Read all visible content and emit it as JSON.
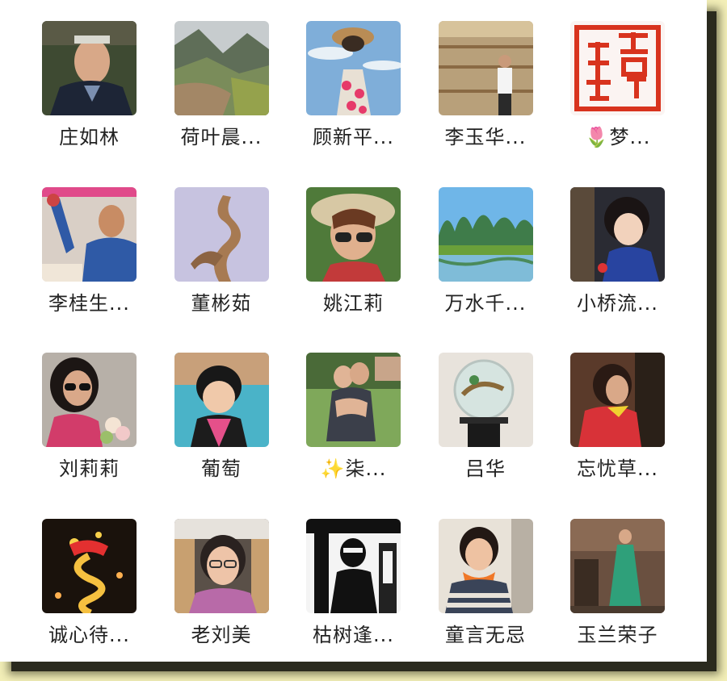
{
  "contacts": [
    {
      "name": "庄如林",
      "avatar": "portrait-man-jacket-icon"
    },
    {
      "name": "荷叶晨...",
      "avatar": "mountain-river-icon"
    },
    {
      "name": "顾新平...",
      "avatar": "girl-straw-hat-icon"
    },
    {
      "name": "李玉华...",
      "avatar": "man-in-atrium-icon"
    },
    {
      "name": "🌷梦...",
      "avatar": "red-seal-stamp-icon"
    },
    {
      "name": "李桂生...",
      "avatar": "man-waving-icon"
    },
    {
      "name": "董彬茹",
      "avatar": "wood-sculpture-icon"
    },
    {
      "name": "姚江莉",
      "avatar": "woman-sunhat-sunglasses-icon"
    },
    {
      "name": "万水千...",
      "avatar": "karst-lake-landscape-icon"
    },
    {
      "name": "小桥流...",
      "avatar": "little-girl-icon"
    },
    {
      "name": "刘莉莉",
      "avatar": "woman-sunglasses-flowers-icon"
    },
    {
      "name": "葡萄",
      "avatar": "child-pink-shirt-icon"
    },
    {
      "name": "✨柒...",
      "avatar": "couple-hugging-icon"
    },
    {
      "name": "吕华",
      "avatar": "painted-plate-icon"
    },
    {
      "name": "忘忧草...",
      "avatar": "woman-red-coat-icon"
    },
    {
      "name": "诚心待...",
      "avatar": "dragon-lantern-icon"
    },
    {
      "name": "老刘美",
      "avatar": "woman-glasses-train-icon"
    },
    {
      "name": "枯树逢...",
      "avatar": "bw-crowd-photo-icon"
    },
    {
      "name": "童言无忌",
      "avatar": "woman-orange-scarf-icon"
    },
    {
      "name": "玉兰荣子",
      "avatar": "woman-green-dress-icon"
    }
  ]
}
